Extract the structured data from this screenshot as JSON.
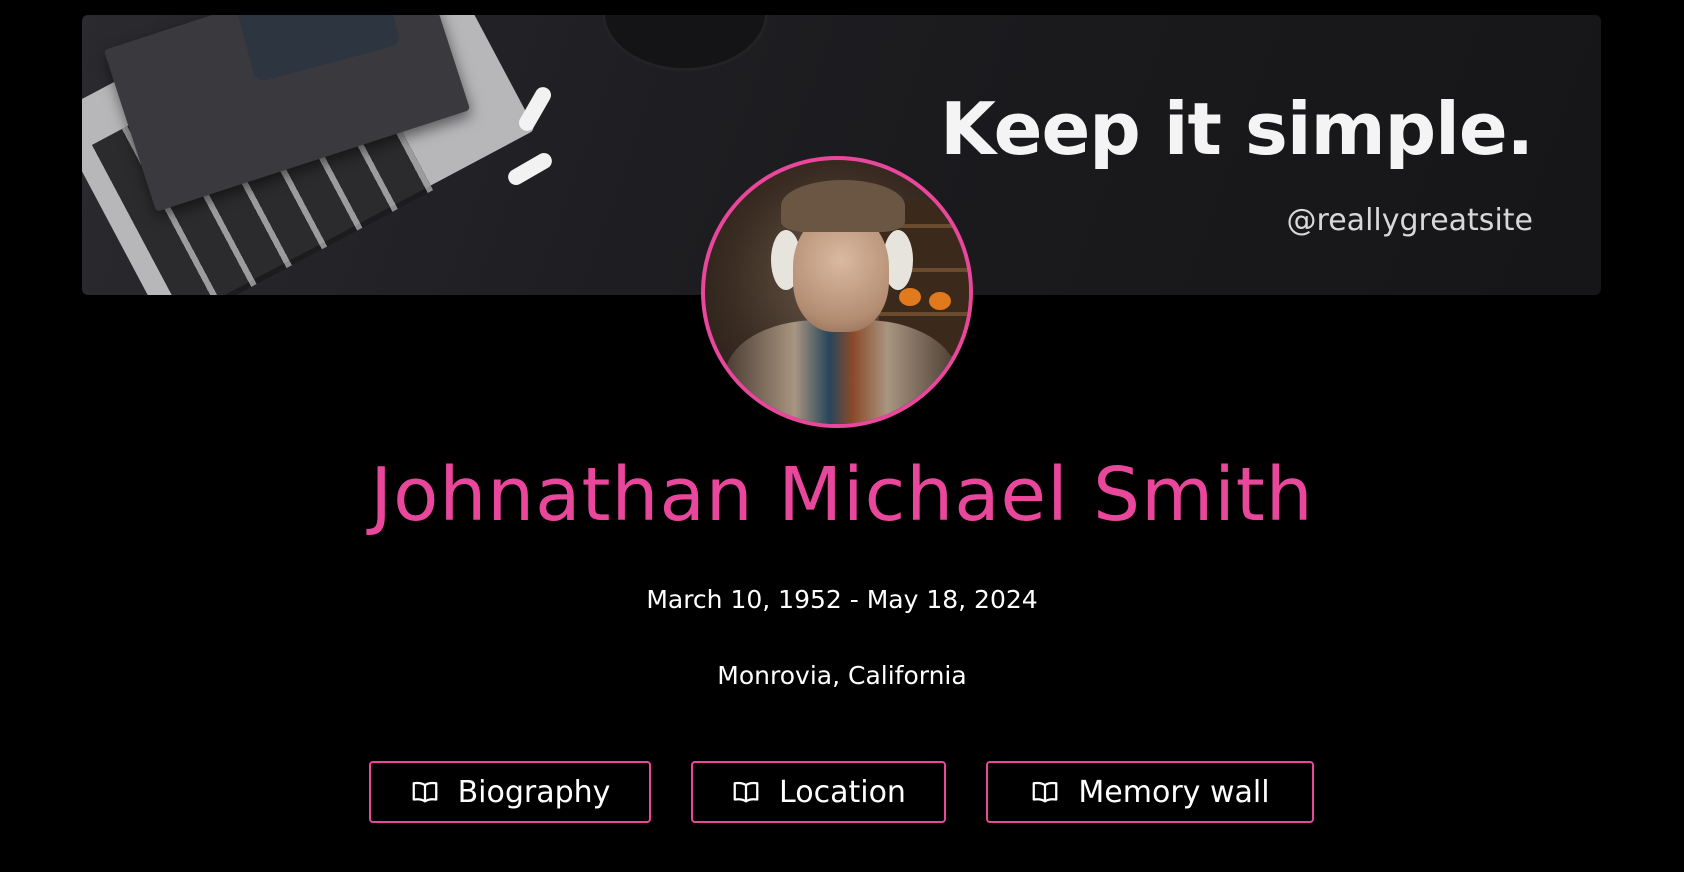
{
  "banner": {
    "title": "Keep it simple.",
    "handle": "@reallygreatsite"
  },
  "profile": {
    "name": "Johnathan Michael Smith",
    "dates": "March 10, 1952 - May 18, 2024",
    "location": "Monrovia, California"
  },
  "nav": {
    "biography_label": "Biography",
    "location_label": "Location",
    "memory_wall_label": "Memory wall"
  },
  "colors": {
    "accent": "#e8479b",
    "background": "#000000",
    "text": "#ffffff"
  },
  "icons": {
    "nav_button_icon": "open-book-icon"
  }
}
